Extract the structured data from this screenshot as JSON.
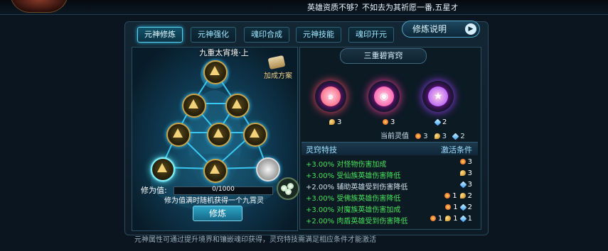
{
  "marquee": "英雄资质不够？不如去为其祈愿一番,五星オ",
  "tabs": [
    "元神修炼",
    "元神强化",
    "魂印合成",
    "元神技能",
    "魂印开元"
  ],
  "active_tab": 0,
  "explain_button": "修炼说明",
  "explain_arrow": "▶",
  "realm_title": "九重太宵境·上",
  "plan_label": "加成方案",
  "cultivation": {
    "label": "修为值:",
    "current": 0,
    "max": 1000,
    "progress_text": "0/1000",
    "hint": "修为值满时随机获得一个九霄灵",
    "button": "修炼"
  },
  "right": {
    "title": "三重碧宵窍",
    "orbs": [
      {
        "gem": "moon",
        "count": "3",
        "color": "#ff4a6a"
      },
      {
        "gem": "fire",
        "count": "3",
        "color": "#ff3fa0"
      },
      {
        "gem": "star",
        "count": "2",
        "color": "#a040ff"
      }
    ],
    "current_label": "当前灵值",
    "current_values": {
      "fire": "3",
      "moon": "3",
      "star": "2"
    },
    "skills_header_left": "灵窍特技",
    "skills_header_right": "激活条件",
    "skills": [
      {
        "text": "+3.00% 对怪物伤害加成",
        "active": true,
        "conds": [
          [
            "fire",
            "3"
          ]
        ]
      },
      {
        "text": "+3.00% 受仙族英雄伤害降低",
        "active": true,
        "conds": [
          [
            "moon",
            "3"
          ]
        ]
      },
      {
        "text": "+2.00% 辅助英雄受到伤害降低",
        "active": false,
        "conds": [
          [
            "star",
            "3"
          ]
        ]
      },
      {
        "text": "+3.00% 受佛族英雄伤害降低",
        "active": true,
        "conds": [
          [
            "fire",
            "1"
          ],
          [
            "moon",
            "2"
          ]
        ]
      },
      {
        "text": "+3.00% 对魔族英雄伤害加成",
        "active": true,
        "conds": [
          [
            "fire",
            "1"
          ],
          [
            "star",
            "2"
          ]
        ]
      },
      {
        "text": "+2.00% 肉盾英雄受到伤害降低",
        "active": true,
        "conds": [
          [
            "fire",
            "1"
          ],
          [
            "moon",
            "1"
          ],
          [
            "star",
            "1"
          ]
        ]
      }
    ]
  },
  "footer": "元神属性可通过提升境界和镶嵌魂印获得，灵窍特技需满足相应条件才能激活"
}
